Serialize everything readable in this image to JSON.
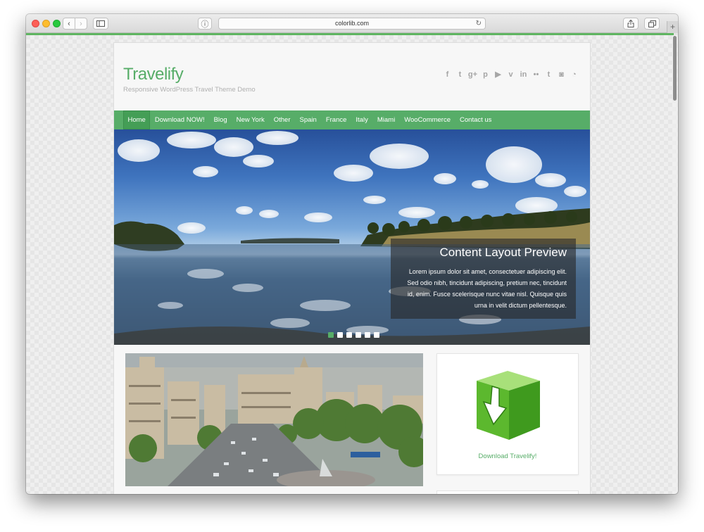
{
  "browser": {
    "url": "colorlib.com",
    "back_glyph": "‹",
    "forward_glyph": "›",
    "info_glyph": "ⓘ",
    "reload_glyph": "↻",
    "plus_glyph": "+",
    "accent_color": "#5fb561"
  },
  "site": {
    "title": "Travelify",
    "tagline": "Responsive WordPress Travel Theme Demo",
    "brand_color": "#57ad68",
    "social_icons": [
      {
        "name": "facebook-icon",
        "glyph": "f"
      },
      {
        "name": "twitter-icon",
        "glyph": "t"
      },
      {
        "name": "google-plus-icon",
        "glyph": "g+"
      },
      {
        "name": "pinterest-icon",
        "glyph": "p"
      },
      {
        "name": "youtube-icon",
        "glyph": "▶"
      },
      {
        "name": "vimeo-icon",
        "glyph": "v"
      },
      {
        "name": "linkedin-icon",
        "glyph": "in"
      },
      {
        "name": "flickr-icon",
        "glyph": "••"
      },
      {
        "name": "tumblr-icon",
        "glyph": "t"
      },
      {
        "name": "instagram-icon",
        "glyph": "◙"
      },
      {
        "name": "rss-icon",
        "glyph": "◔"
      }
    ]
  },
  "nav": {
    "items": [
      "Home",
      "Download NOW!",
      "Blog",
      "New York",
      "Other",
      "Spain",
      "France",
      "Italy",
      "Miami",
      "WooCommerce",
      "Contact us"
    ],
    "active_index": 0
  },
  "slider": {
    "caption_title": "Content Layout Preview",
    "caption_text": "Lorem ipsum dolor sit amet, consectetuer adipiscing elit. Sed odio nibh, tincidunt adipiscing, pretium nec, tincidunt id, enim. Fusce scelerisque nunc vitae nisl. Quisque quis urna in velit dictum pellentesque.",
    "slide_count": 6,
    "active_slide": 1
  },
  "sidebar": {
    "download_link": "Download Travelify!"
  }
}
